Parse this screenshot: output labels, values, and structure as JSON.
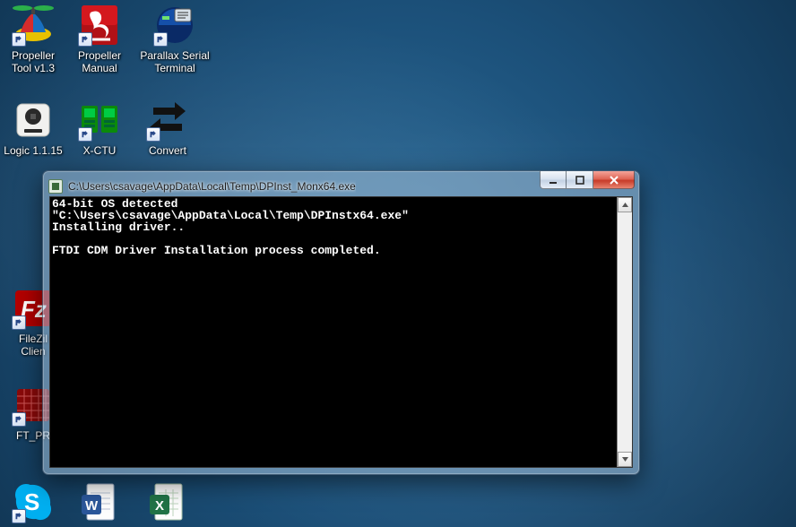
{
  "desktop": {
    "icons": [
      {
        "label": "Propeller\nTool v1.3"
      },
      {
        "label": "Propeller\nManual"
      },
      {
        "label": "Parallax Serial\nTerminal"
      },
      {
        "label": "Logic 1.1.15"
      },
      {
        "label": "X-CTU"
      },
      {
        "label": "Convert"
      },
      {
        "label": "FileZil\nClien"
      },
      {
        "label": "FT_PR"
      },
      {
        "label": ""
      },
      {
        "label": ""
      },
      {
        "label": ""
      }
    ]
  },
  "window": {
    "title": "C:\\Users\\csavage\\AppData\\Local\\Temp\\DPInst_Monx64.exe",
    "console_lines": [
      "64-bit OS detected",
      "\"C:\\Users\\csavage\\AppData\\Local\\Temp\\DPInstx64.exe\"",
      "Installing driver..",
      "",
      "FTDI CDM Driver Installation process completed."
    ]
  }
}
